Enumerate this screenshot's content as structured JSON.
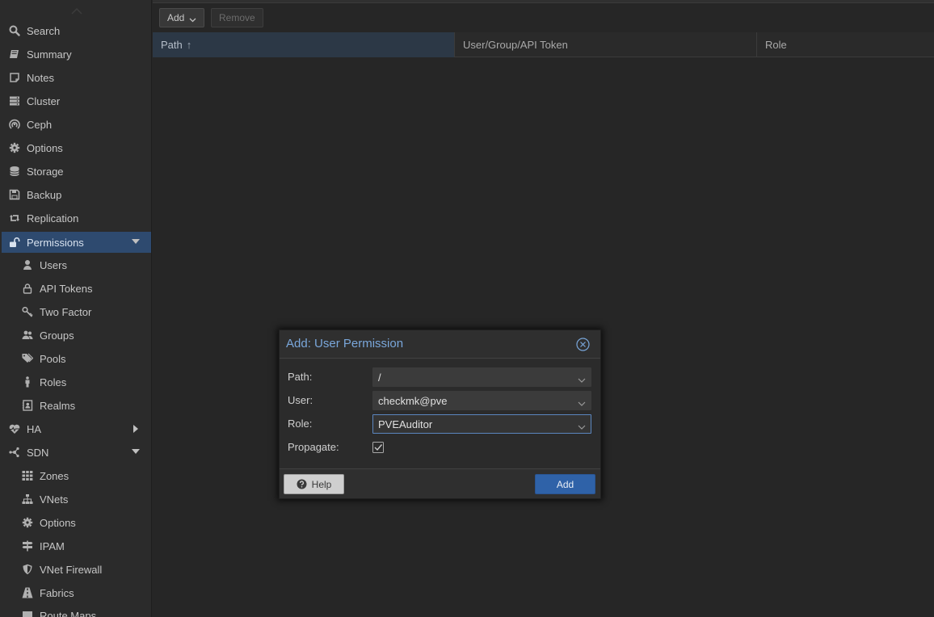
{
  "sidebar": {
    "items": [
      {
        "label": "Search",
        "icon": "search-icon"
      },
      {
        "label": "Summary",
        "icon": "book-icon"
      },
      {
        "label": "Notes",
        "icon": "note-icon"
      },
      {
        "label": "Cluster",
        "icon": "server-icon"
      },
      {
        "label": "Ceph",
        "icon": "ceph-icon"
      },
      {
        "label": "Options",
        "icon": "gear-icon"
      },
      {
        "label": "Storage",
        "icon": "database-icon"
      },
      {
        "label": "Backup",
        "icon": "floppy-icon"
      },
      {
        "label": "Replication",
        "icon": "retweet-icon"
      },
      {
        "label": "Permissions",
        "icon": "unlock-icon",
        "expanded": true
      },
      {
        "label": "Users",
        "icon": "user-icon"
      },
      {
        "label": "API Tokens",
        "icon": "lock-icon"
      },
      {
        "label": "Two Factor",
        "icon": "key-icon"
      },
      {
        "label": "Groups",
        "icon": "users-icon"
      },
      {
        "label": "Pools",
        "icon": "tags-icon"
      },
      {
        "label": "Roles",
        "icon": "male-icon"
      },
      {
        "label": "Realms",
        "icon": "address-book-icon"
      },
      {
        "label": "HA",
        "icon": "heartbeat-icon",
        "expanded": false
      },
      {
        "label": "SDN",
        "icon": "sdn-icon",
        "expanded": true
      },
      {
        "label": "Zones",
        "icon": "grid-icon"
      },
      {
        "label": "VNets",
        "icon": "sitemap-icon"
      },
      {
        "label": "Options",
        "icon": "gear-icon"
      },
      {
        "label": "IPAM",
        "icon": "signpost-icon"
      },
      {
        "label": "VNet Firewall",
        "icon": "shield-icon"
      },
      {
        "label": "Fabrics",
        "icon": "road-icon"
      },
      {
        "label": "Route Maps",
        "icon": "route-icon"
      }
    ]
  },
  "toolbar": {
    "add_label": "Add",
    "remove_label": "Remove"
  },
  "grid": {
    "columns": [
      "Path",
      "User/Group/API Token",
      "Role"
    ],
    "sort_indicator": "↑"
  },
  "dialog": {
    "title": "Add: User Permission",
    "fields": {
      "path_label": "Path:",
      "path_value": "/",
      "user_label": "User:",
      "user_value": "checkmk@pve",
      "role_label": "Role:",
      "role_value": "PVEAuditor",
      "propagate_label": "Propagate:",
      "propagate_checked": true
    },
    "help_label": "Help",
    "add_label": "Add"
  },
  "colors": {
    "accent": "#2f62a8",
    "active_nav": "#2e4a6f",
    "title": "#7aa7db"
  }
}
